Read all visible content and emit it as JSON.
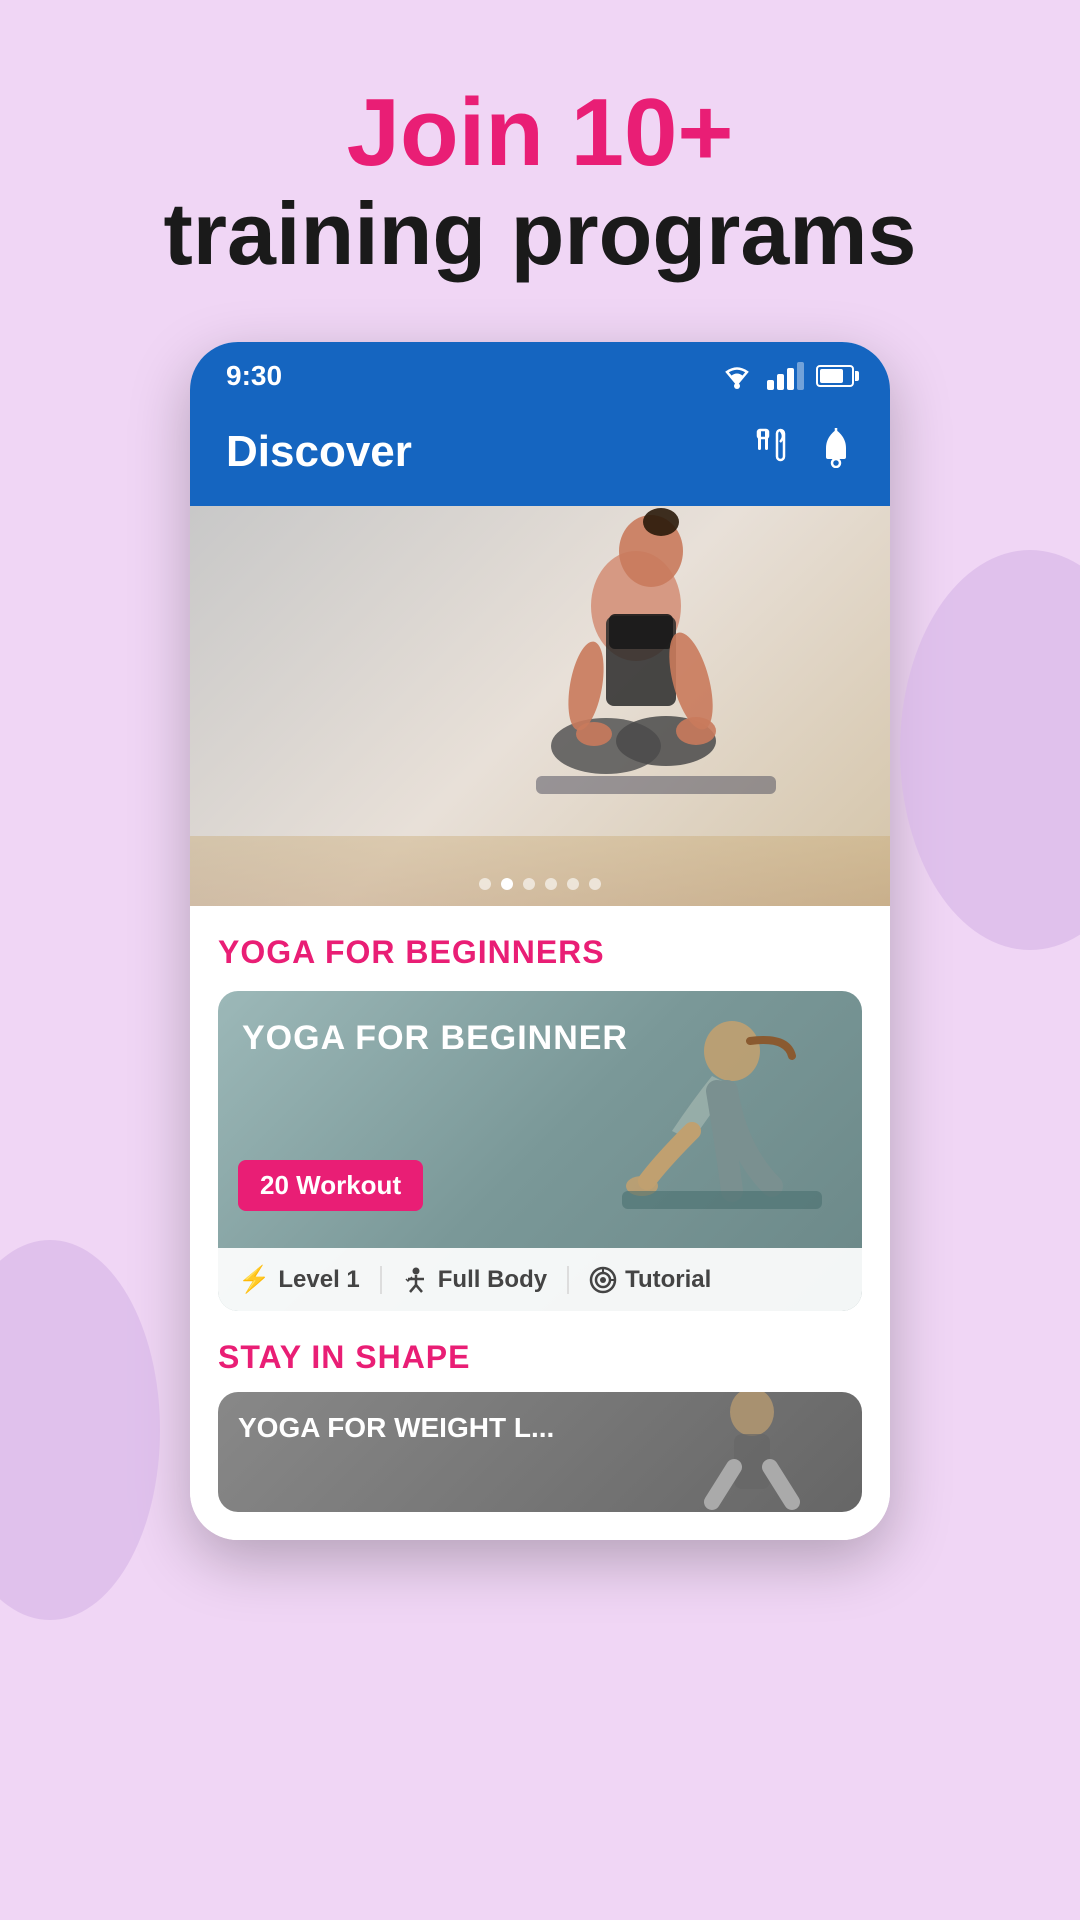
{
  "promo": {
    "title_highlight": "Join 10+",
    "title_normal": "training programs"
  },
  "status_bar": {
    "time": "9:30"
  },
  "app_bar": {
    "title": "Discover"
  },
  "hero": {
    "carousel_dots": [
      1,
      2,
      3,
      4,
      5,
      6
    ],
    "active_dot": 1
  },
  "sections": [
    {
      "id": "yoga_beginners",
      "title": "YOGA FOR BEGINNERS",
      "card": {
        "title": "YOGA FOR BEGINNER",
        "badge": "20 Workout",
        "tags": [
          {
            "icon": "⚡",
            "label": "Level 1"
          },
          {
            "icon": "🏃",
            "label": "Full Body"
          },
          {
            "icon": "🎯",
            "label": "Tutorial"
          }
        ]
      }
    },
    {
      "id": "stay_in_shape",
      "title": "STAY IN SHAPE",
      "card": {
        "title": "YOGA FOR WEIGHT L..."
      }
    }
  ],
  "icons": {
    "food": "🍽",
    "bell": "🔔",
    "bolt": "⚡",
    "run": "🏃",
    "target": "🎯"
  }
}
